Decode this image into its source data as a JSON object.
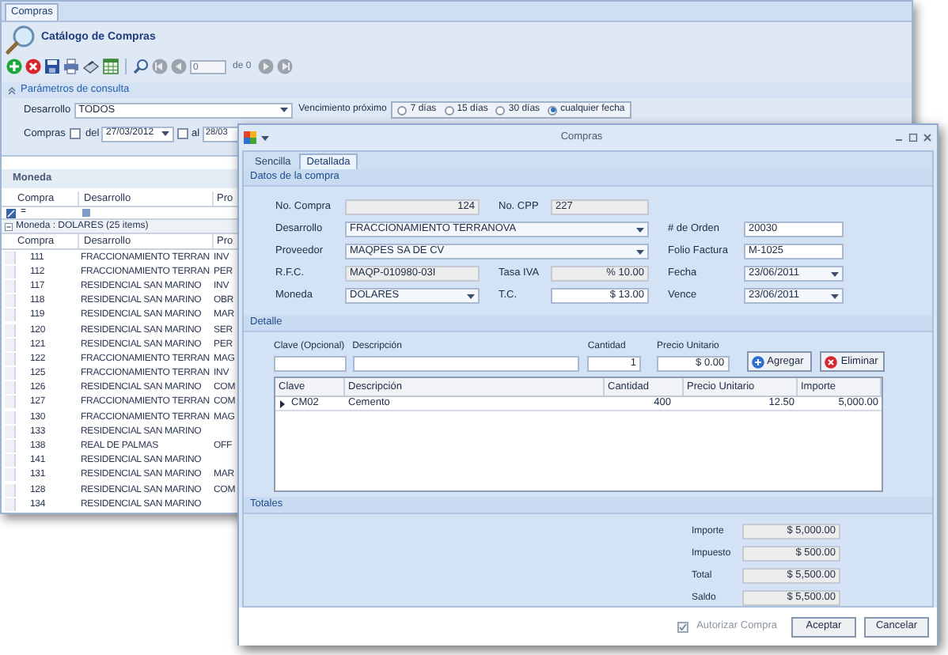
{
  "back_window": {
    "tab": {
      "label": "Compras",
      "selected": true
    },
    "title": "Catálogo de Compras",
    "toolbar": {
      "page_input": "0",
      "page_total": "de 0"
    },
    "params": {
      "title": "Parámetros de consulta",
      "desarrollo_label": "Desarrollo",
      "desarrollo_value": "TODOS",
      "vencimiento_label": "Vencimiento próximo",
      "vencimiento_options": [
        {
          "label": "7 días",
          "selected": false
        },
        {
          "label": "15 días",
          "selected": false
        },
        {
          "label": "30 días",
          "selected": false
        },
        {
          "label": "cualquier fecha",
          "selected": true
        }
      ],
      "compras_label": "Compras",
      "from": {
        "label": "del",
        "checked": false,
        "value": "27/03/2012"
      },
      "to": {
        "label": "al",
        "checked": false,
        "value": "28/03"
      }
    },
    "group_panel": "Moneda",
    "filter_columns": [
      "Compra",
      "Desarrollo",
      "Pro"
    ],
    "columns": [
      "Compra",
      "Desarrollo",
      "Pro"
    ],
    "filter_operator": "=",
    "group_row": "Moneda : DOLARES (25 items)",
    "rows": [
      {
        "compra": "111",
        "desarrollo": "FRACCIONAMIENTO TERRAN",
        "column_3": "INV"
      },
      {
        "compra": "112",
        "desarrollo": "FRACCIONAMIENTO TERRAN",
        "column_3": "PER"
      },
      {
        "compra": "117",
        "desarrollo": "RESIDENCIAL SAN MARINO",
        "column_3": "INV"
      },
      {
        "compra": "118",
        "desarrollo": "RESIDENCIAL SAN MARINO",
        "column_3": "OBR"
      },
      {
        "compra": "119",
        "desarrollo": "RESIDENCIAL SAN MARINO",
        "column_3": "MAR"
      },
      {
        "compra": "120",
        "desarrollo": "RESIDENCIAL SAN MARINO",
        "column_3": "SER"
      },
      {
        "compra": "121",
        "desarrollo": "RESIDENCIAL SAN MARINO",
        "column_3": "PER"
      },
      {
        "compra": "122",
        "desarrollo": "FRACCIONAMIENTO TERRAN",
        "column_3": "MAG"
      },
      {
        "compra": "125",
        "desarrollo": "FRACCIONAMIENTO TERRAN",
        "column_3": "INV"
      },
      {
        "compra": "126",
        "desarrollo": "RESIDENCIAL SAN MARINO",
        "column_3": "COM"
      },
      {
        "compra": "127",
        "desarrollo": "FRACCIONAMIENTO TERRAN",
        "column_3": "COM"
      },
      {
        "compra": "130",
        "desarrollo": "FRACCIONAMIENTO TERRAN",
        "column_3": "MAG"
      },
      {
        "compra": "133",
        "desarrollo": "RESIDENCIAL SAN MARINO"
      },
      {
        "compra": "138",
        "desarrollo": "REAL DE PALMAS",
        "column_3": "OFF"
      },
      {
        "compra": "141",
        "desarrollo": "RESIDENCIAL SAN MARINO"
      },
      {
        "compra": "131",
        "desarrollo": "RESIDENCIAL SAN MARINO",
        "column_3": "MAR"
      },
      {
        "compra": "128",
        "desarrollo": "RESIDENCIAL SAN MARINO",
        "column_3": "COM"
      },
      {
        "compra": "134",
        "desarrollo": "RESIDENCIAL SAN MARINO"
      }
    ]
  },
  "dialog": {
    "title": "Compras",
    "tabs": [
      {
        "label": "Sencilla",
        "selected": false
      },
      {
        "label": "Detallada",
        "selected": true
      }
    ],
    "datos": {
      "title": "Datos de la compra",
      "rows": [
        [
          {
            "label": "No. Compra",
            "value": "124",
            "kind": "readonlynum"
          },
          {
            "label": "No. CPP",
            "value": "227",
            "kind": "readonly"
          }
        ],
        [
          {
            "label": "Desarrollo",
            "value": "FRACCIONAMIENTO TERRANOVA",
            "kind": "widecombo"
          },
          {
            "label": "# de Orden",
            "value": "20030",
            "kind": "text"
          }
        ],
        [
          {
            "label": "Proveedor",
            "value": "MAQPES SA DE CV",
            "kind": "widecombo"
          },
          {
            "label": "Folio Factura",
            "value": "M-1025",
            "kind": "text"
          }
        ],
        [
          {
            "label": "R.F.C.",
            "value": "MAQP-010980-03I",
            "kind": "readonly"
          },
          {
            "label": "Tasa IVA",
            "value": "% 10.00",
            "kind": "readonlynum"
          },
          {
            "label": "Fecha",
            "value": "23/06/2011",
            "kind": "combo"
          }
        ],
        [
          {
            "label": "Moneda",
            "value": "DOLARES",
            "kind": "combo"
          },
          {
            "label": "T.C.",
            "value": "$ 13.00",
            "kind": "number"
          },
          {
            "label": "Vence",
            "value": "23/06/2011",
            "kind": "combo"
          }
        ]
      ]
    },
    "detalle": {
      "title": "Detalle",
      "inputs": [
        {
          "label": "Clave (Opcional)"
        },
        {
          "label": "Descripción"
        },
        {
          "label": "Cantidad",
          "value": "1"
        },
        {
          "label": "Precio Unitario",
          "value": "$ 0.00"
        }
      ],
      "buttons": [
        "Agregar",
        "Eliminar"
      ],
      "columns": [
        "Clave",
        "Descripción",
        "Cantidad",
        "Precio Unitario",
        "Importe"
      ],
      "rows": [
        {
          "clave": "CM02",
          "descripcion": "Cemento",
          "cantidad": "400",
          "precio": "12.50",
          "importe": "5,000.00",
          "selected": true
        }
      ]
    },
    "totales": {
      "title": "Totales",
      "items": [
        {
          "label": "Importe",
          "value": "$ 5,000.00"
        },
        {
          "label": "Impuesto",
          "value": "$ 500.00"
        },
        {
          "label": "Total",
          "value": "$ 5,500.00"
        },
        {
          "label": "Saldo",
          "value": "$ 5,500.00"
        }
      ]
    },
    "autorizar": {
      "label": "Autorizar Compra",
      "checked": true,
      "disabled": true
    },
    "buttons": [
      "Aceptar",
      "Cancelar"
    ]
  }
}
